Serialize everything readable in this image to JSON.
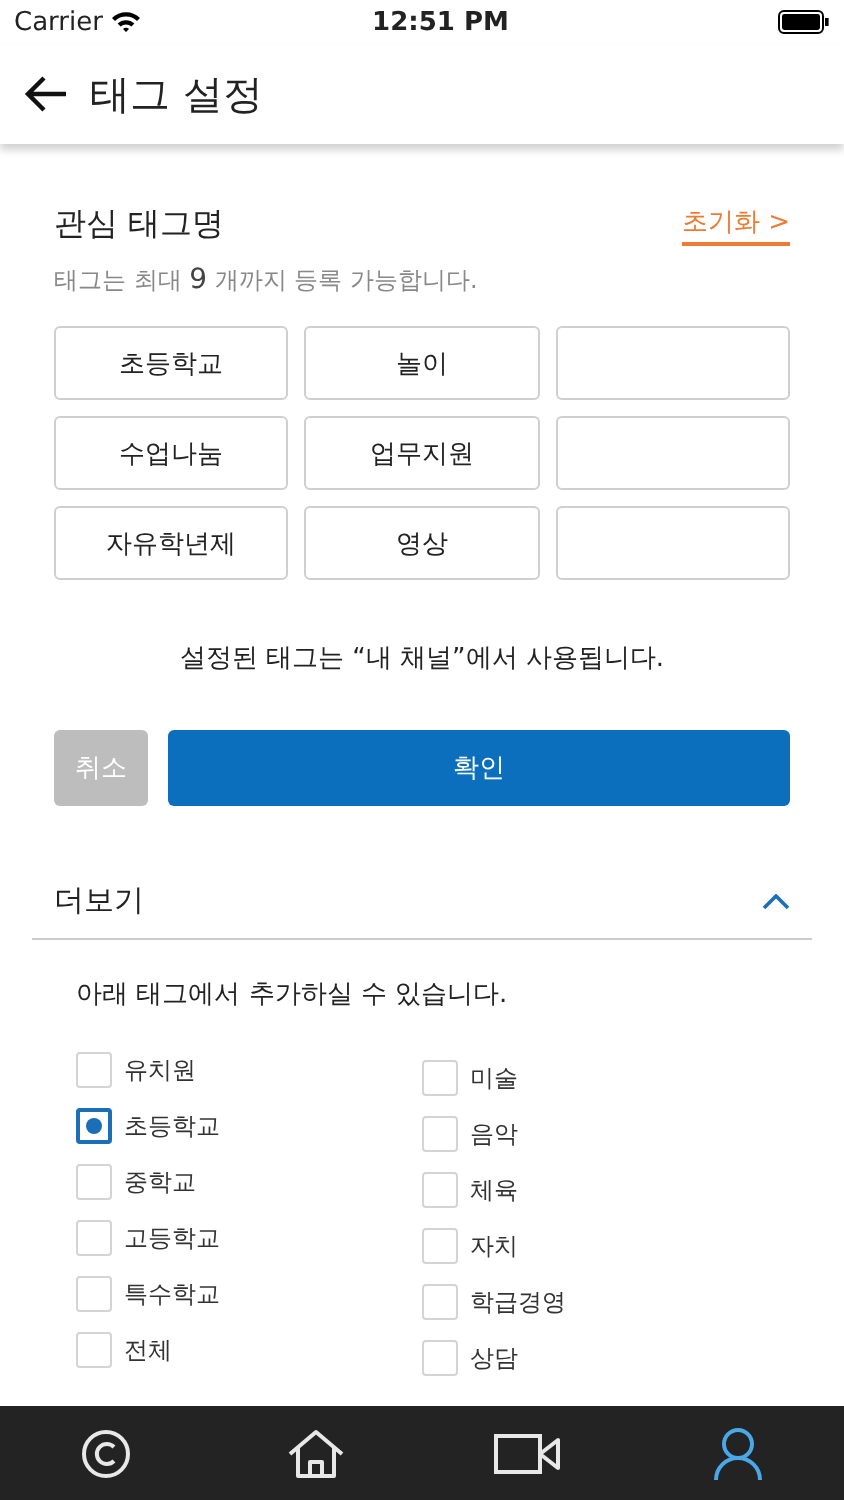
{
  "status_bar": {
    "carrier": "Carrier",
    "time": "12:51 PM"
  },
  "header": {
    "title": "태그 설정"
  },
  "interest": {
    "title": "관심 태그명",
    "reset": "초기화 >",
    "hint": "태그는 최대 **9** 개까지 등록 가능합니다.",
    "tag_rows": [
      [
        "초등학교",
        "놀이"
      ],
      [
        "수업나눔",
        "업무지원"
      ],
      [
        "자유학년제",
        "영상"
      ]
    ],
    "note": "설정된 태그는 “내 채널”에서 사용됩니다."
  },
  "buttons": {
    "cancel": "취소",
    "confirm": "확인"
  },
  "more": {
    "title": "더보기",
    "expanded": true,
    "description": "아래 태그에서 추가하실 수 있습니다.",
    "left": [
      {
        "label": "유치원",
        "checked": false
      },
      {
        "label": "초등학교",
        "checked": true
      },
      {
        "label": "중학교",
        "checked": false
      },
      {
        "label": "고등학교",
        "checked": false
      },
      {
        "label": "특수학교",
        "checked": false
      },
      {
        "label": "전체",
        "checked": false
      }
    ],
    "right": [
      {
        "label": "미술",
        "checked": false
      },
      {
        "label": "음악",
        "checked": false
      },
      {
        "label": "체육",
        "checked": false
      },
      {
        "label": "자치",
        "checked": false
      },
      {
        "label": "학급경영",
        "checked": false
      },
      {
        "label": "상담",
        "checked": false
      }
    ]
  },
  "tab_bar": [
    {
      "kind": "copyright",
      "selected": false
    },
    {
      "kind": "home",
      "selected": false
    },
    {
      "kind": "video",
      "selected": false
    },
    {
      "kind": "person",
      "selected": true
    }
  ]
}
